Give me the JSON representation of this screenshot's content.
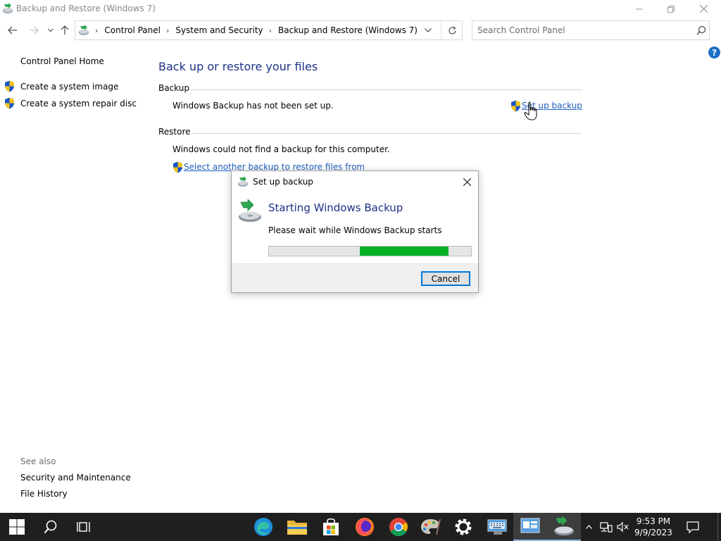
{
  "window": {
    "title": "Backup and Restore (Windows 7)",
    "minimize_icon": "minimize-icon",
    "restore_icon": "restore-icon",
    "close_icon": "close-icon"
  },
  "address": {
    "crumbs": [
      "Control Panel",
      "System and Security",
      "Backup and Restore (Windows 7)"
    ],
    "search_placeholder": "Search Control Panel"
  },
  "left_pane": {
    "home": "Control Panel Home",
    "create_image": "Create a system image",
    "create_repair": "Create a system repair disc",
    "see_also": "See also",
    "security": "Security and Maintenance",
    "file_history": "File History"
  },
  "main": {
    "heading": "Back up or restore your files",
    "backup_label": "Backup",
    "backup_status": "Windows Backup has not been set up.",
    "setup_link": "Set up backup",
    "restore_label": "Restore",
    "restore_status": "Windows could not find a backup for this computer.",
    "select_link": "Select another backup to restore files from"
  },
  "dialog": {
    "title": "Set up backup",
    "heading": "Starting Windows Backup",
    "text": "Please wait while Windows Backup starts",
    "progress_start": 0.45,
    "progress_end": 0.89,
    "cancel": "Cancel"
  },
  "taskbar": {
    "time": "9:53 PM",
    "date": "9/9/2023",
    "accent": "#06b025"
  }
}
